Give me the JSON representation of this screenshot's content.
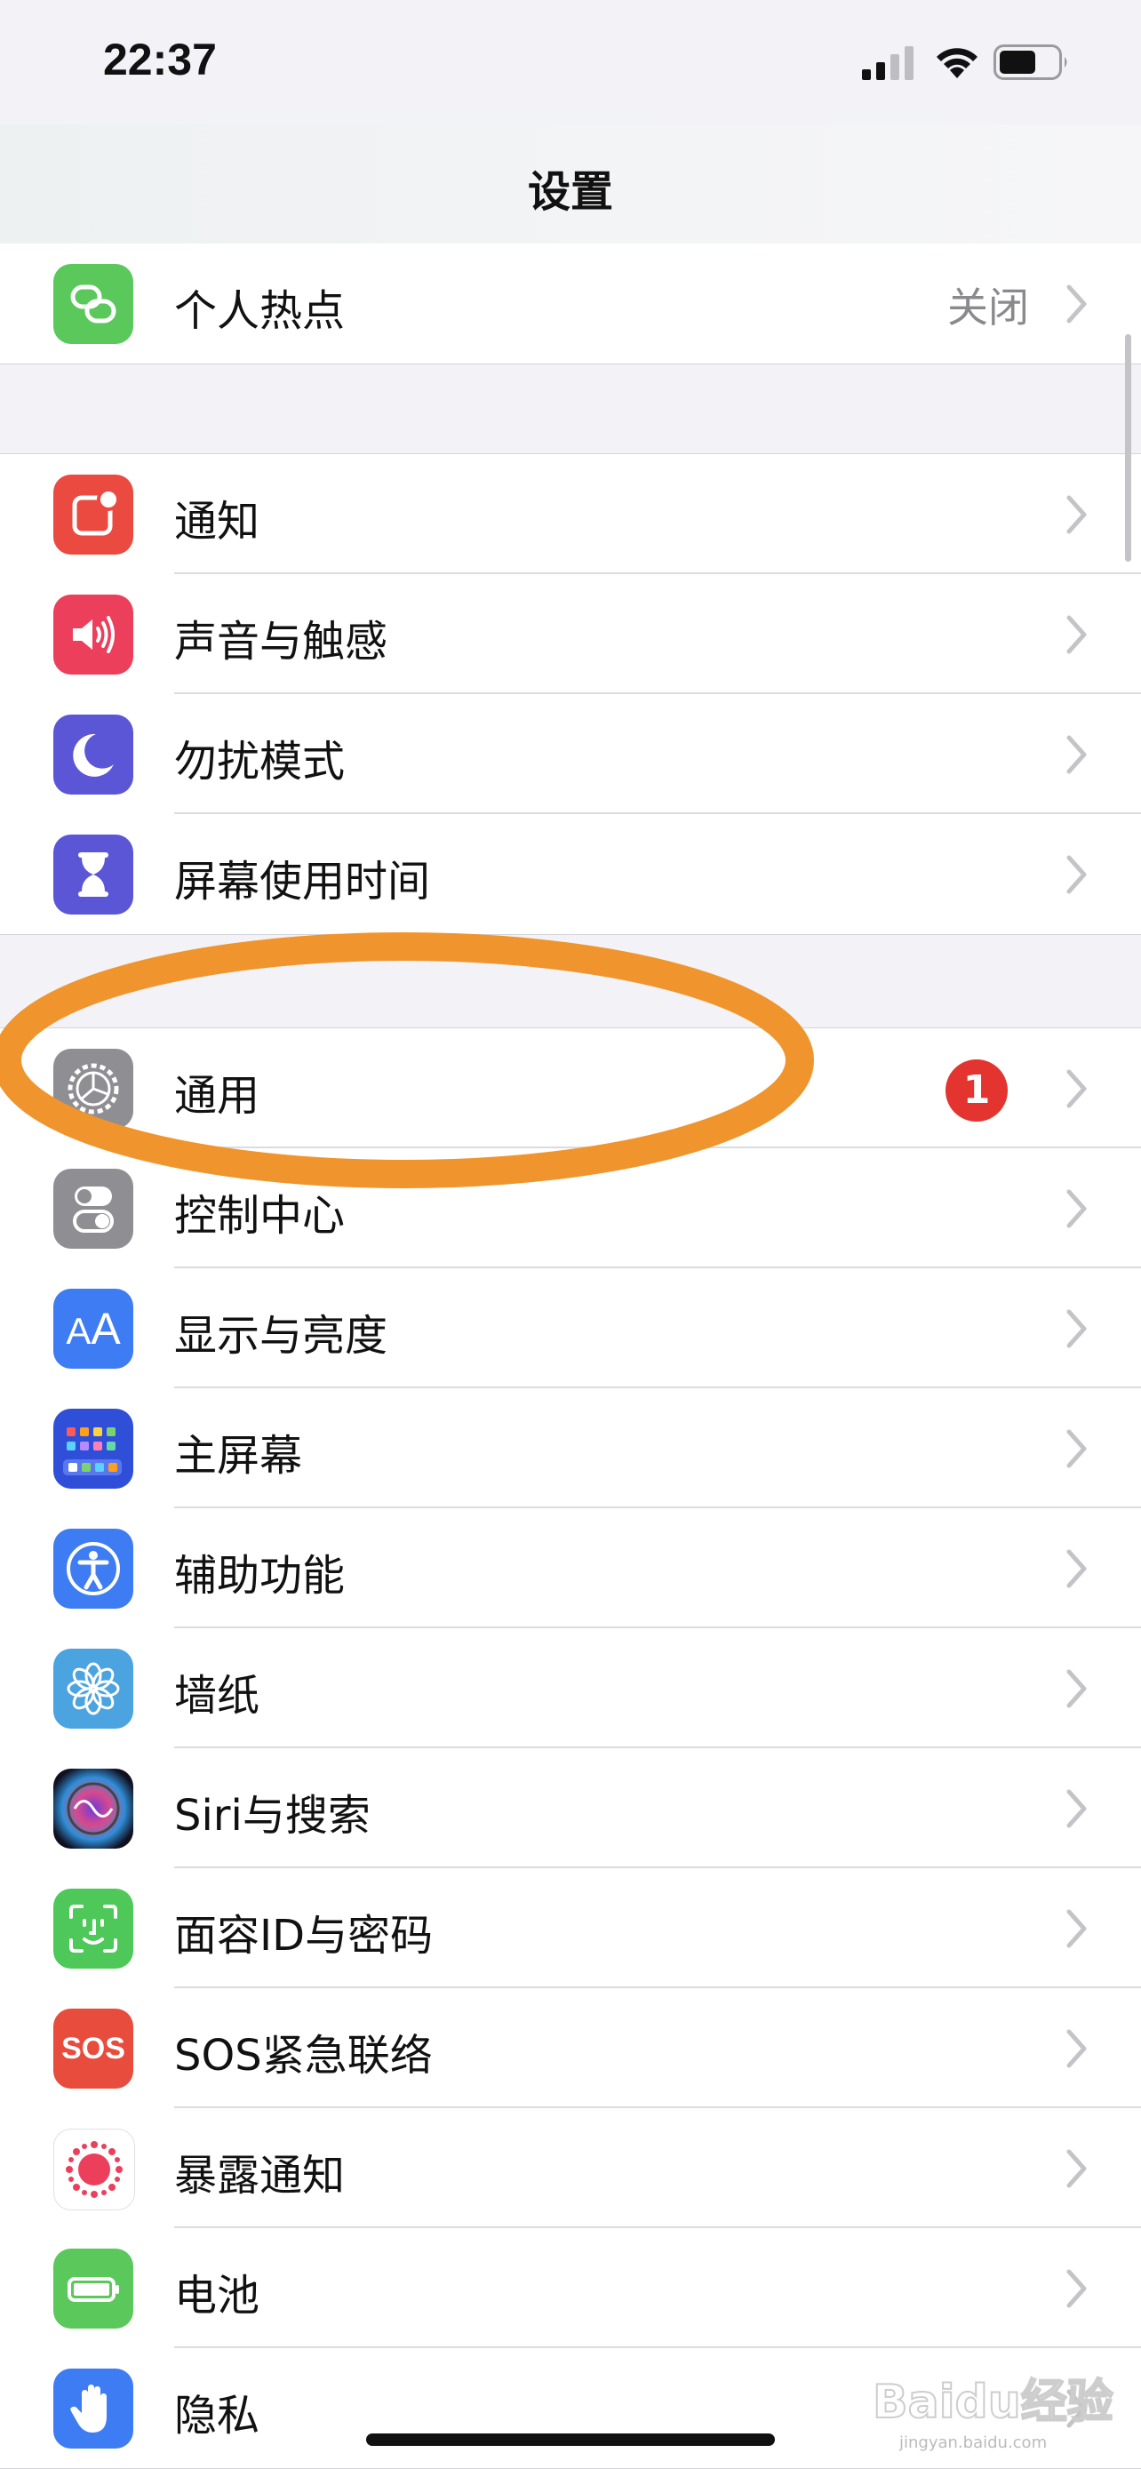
{
  "status_bar": {
    "time": "22:37"
  },
  "nav": {
    "title": "设置"
  },
  "group1": [
    {
      "label": "个人热点",
      "value": "关闭",
      "icon": "hotspot-icon",
      "color": "#5ac85a"
    }
  ],
  "group2": [
    {
      "label": "通知",
      "icon": "notification-icon",
      "color": "#ea4a3f"
    },
    {
      "label": "声音与触感",
      "icon": "speaker-icon",
      "color": "#ec3f5c"
    },
    {
      "label": "勿扰模式",
      "icon": "moon-icon",
      "color": "#5a56d6"
    },
    {
      "label": "屏幕使用时间",
      "icon": "hourglass-icon",
      "color": "#5a56d6"
    }
  ],
  "group3": [
    {
      "label": "通用",
      "badge": "1",
      "icon": "gear-icon",
      "color": "#8e8e93"
    },
    {
      "label": "控制中心",
      "icon": "toggles-icon",
      "color": "#8e8e93"
    },
    {
      "label": "显示与亮度",
      "icon": "text-size-icon",
      "color": "#3d7cf2"
    },
    {
      "label": "主屏幕",
      "icon": "app-grid-icon",
      "color": "#2f4fd8"
    },
    {
      "label": "辅助功能",
      "icon": "accessibility-icon",
      "color": "#3d7cf2"
    },
    {
      "label": "墙纸",
      "icon": "flower-icon",
      "color": "#4ba3e0"
    },
    {
      "label": "Siri与搜索",
      "icon": "siri-icon",
      "color": "#1a1a2e"
    },
    {
      "label": "面容ID与密码",
      "icon": "face-id-icon",
      "color": "#4fc85a"
    },
    {
      "label": "SOS紧急联络",
      "icon": "sos-icon",
      "color": "#e74c3c",
      "icon_text": "SOS"
    },
    {
      "label": "暴露通知",
      "icon": "exposure-icon",
      "color": "#ffffff"
    },
    {
      "label": "电池",
      "icon": "battery-icon",
      "color": "#5ac85a"
    },
    {
      "label": "隐私",
      "icon": "hand-icon",
      "color": "#3d7cf2"
    }
  ],
  "annotation": {
    "color": "#f0952d"
  },
  "watermark": {
    "text": "Baidu经验",
    "sub": "jingyan.baidu.com"
  }
}
